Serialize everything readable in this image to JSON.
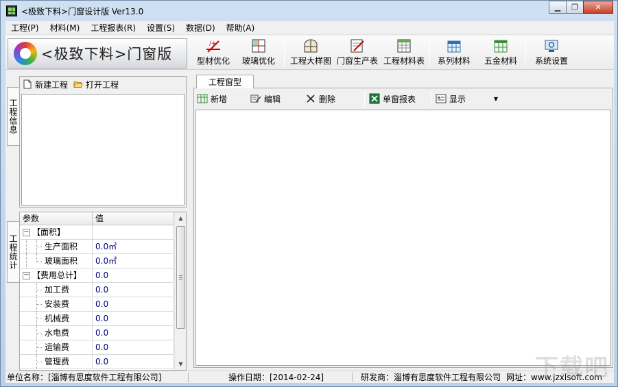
{
  "window": {
    "title": "<极致下料>门窗设计版  Ver13.0",
    "minimize": "▁",
    "restore": "❐",
    "close": "✕"
  },
  "menu": [
    "工程(P)",
    "材料(M)",
    "工程报表(R)",
    "设置(S)",
    "数据(D)",
    "帮助(A)"
  ],
  "logo": {
    "text": "<极致下料>门窗版"
  },
  "toolbar": [
    {
      "label": "型材优化",
      "icon": "profile-optimize-icon"
    },
    {
      "label": "玻璃优化",
      "icon": "glass-optimize-icon"
    },
    {
      "label": "工程大样图",
      "icon": "drawing-icon"
    },
    {
      "label": "门窗生产表",
      "icon": "production-sheet-icon"
    },
    {
      "label": "工程材料表",
      "icon": "material-sheet-icon"
    },
    {
      "label": "系列材料",
      "icon": "series-icon"
    },
    {
      "label": "五金材料",
      "icon": "hardware-icon"
    },
    {
      "label": "系统设置",
      "icon": "settings-icon"
    }
  ],
  "left": {
    "tab1": "工程信息",
    "tab2": "工程统计",
    "new_project": "新建工程",
    "open_project": "打开工程",
    "grid": {
      "headers": [
        "参数",
        "值"
      ],
      "rows": [
        {
          "param": "【面积】",
          "value": "",
          "type": "group"
        },
        {
          "param": "生产面积",
          "value": "0.0㎡",
          "type": "child"
        },
        {
          "param": "玻璃面积",
          "value": "0.0㎡",
          "type": "child"
        },
        {
          "param": "【费用总计】",
          "value": "0.0",
          "type": "group"
        },
        {
          "param": "加工费",
          "value": "0.0",
          "type": "child"
        },
        {
          "param": "安装费",
          "value": "0.0",
          "type": "child"
        },
        {
          "param": "机械费",
          "value": "0.0",
          "type": "child"
        },
        {
          "param": "水电费",
          "value": "0.0",
          "type": "child"
        },
        {
          "param": "运输费",
          "value": "0.0",
          "type": "child"
        },
        {
          "param": "管理费",
          "value": "0.0",
          "type": "child"
        }
      ]
    }
  },
  "right": {
    "tab": "工程窗型",
    "tools": {
      "add": "新增",
      "edit": "编辑",
      "delete": "删除",
      "report": "单窗报表",
      "display": "显示"
    }
  },
  "status": {
    "company": "单位名称：[淄博有思度软件工程有限公司]",
    "date": "操作日期：[2014-02-24]",
    "developer": "研发商：淄博有思度软件工程有限公司",
    "website": "网址：www.jzxlsoft.com"
  },
  "watermark": "下载吧"
}
